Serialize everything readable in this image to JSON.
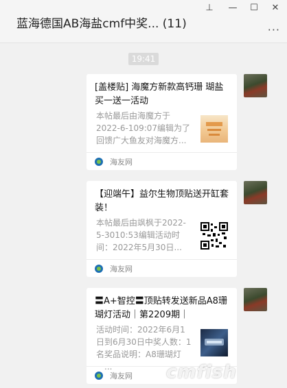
{
  "header": {
    "title": "蓝海德国AB海盐cmf中奖... (11)",
    "pin_icon": "pin-icon",
    "minimize_icon": "minimize-icon",
    "maximize_icon": "maximize-icon",
    "close_icon": "close-icon",
    "more_label": "···"
  },
  "timestamp": "19:41",
  "messages": [
    {
      "title": "[盖楼贴] 海魔方新款高钙珊 瑚盐买一送一活动",
      "desc": "本帖最后由海魔方于2022-6-109:07编辑为了回馈广大鱼友对海魔方...",
      "source": "海友网"
    },
    {
      "title": "【迎端午】益尔生物顶贴送开缸套装！",
      "desc": "本帖最后由飒枫于2022-5-3010:53编辑活动时间：2022年5月30日...",
      "source": "海友网"
    },
    {
      "title": "〓A+智控〓顶贴转发送新品A8珊 瑚灯活动｜第2209期｜",
      "desc": "活动时间：2022年6月1日到6月30日中奖人数：1名奖品说明：A8珊瑚灯一...",
      "source": "海友网"
    }
  ],
  "watermark": "cmfish"
}
